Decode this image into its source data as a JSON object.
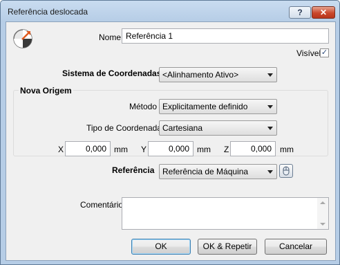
{
  "window": {
    "title": "Referência deslocada",
    "help_label": "?",
    "close_label": "✕"
  },
  "form": {
    "nome_label": "Nome",
    "nome_value": "Referência 1",
    "visivel_label": "Visível",
    "visivel_checked": true,
    "sistema_label": "Sistema de Coordenadas",
    "sistema_value": "<Alinhamento Ativo>",
    "nova_origem_label": "Nova Origem",
    "metodo_label": "Método",
    "metodo_value": "Explicitamente definido",
    "tipo_label": "Tipo de Coordenada",
    "tipo_value": "Cartesiana",
    "x_label": "X",
    "x_value": "0,000",
    "x_unit": "mm",
    "y_label": "Y",
    "y_value": "0,000",
    "y_unit": "mm",
    "z_label": "Z",
    "z_value": "0,000",
    "z_unit": "mm",
    "referencia_label": "Referência",
    "referencia_value": "Referência de Máquina",
    "comentario_label": "Comentário",
    "comentario_value": ""
  },
  "buttons": {
    "ok": "OK",
    "ok_repetir": "OK & Repetir",
    "cancelar": "Cancelar"
  },
  "icons": {
    "dialog_icon": "coordinate-frame-icon",
    "pick_button_icon": "mouse-pick-icon"
  },
  "colors": {
    "accent": "#e05a1e",
    "close_button": "#c9472c",
    "title_bar": "#c9dcf0"
  }
}
